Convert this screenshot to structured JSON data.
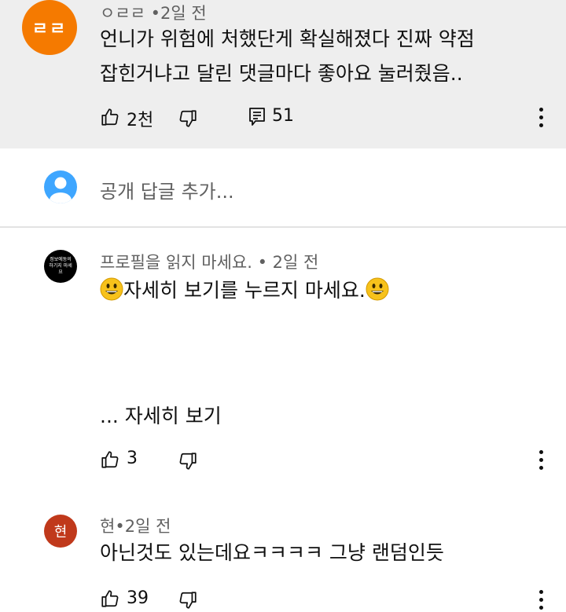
{
  "top_comment": {
    "avatar_text": "ㄹㄹ",
    "author": "ㅇㄹㄹ",
    "separator": "•",
    "time": "2일 전",
    "text_line1": "언니가 위험에 처했단게 확실해졌다 진짜 약점",
    "text_line2": "잡힌거냐고 달린 댓글마다 좋아요 눌러줬음..",
    "likes": "2천",
    "replies": "51"
  },
  "reply_box": {
    "placeholder": "공개 답글 추가..."
  },
  "comment2": {
    "avatar_text": "정보에동의하기지 마세요",
    "author": "프로필을 읽지 마세요.",
    "separator": "•",
    "time": "2일 전",
    "text": "자세히 보기를 누르지 마세요.",
    "more_label": "... 자세히 보기",
    "likes": "3"
  },
  "comment3": {
    "avatar_text": "현",
    "author": "현",
    "separator": "•",
    "time": "2일 전",
    "text": "아닌것도 있는데요ㅋㅋㅋㅋ 그냥 랜덤인듯",
    "likes": "39"
  },
  "colors": {
    "highlight_bg": "#eeeeee",
    "avatar_orange": "#f57a00",
    "avatar_red": "#c0391b",
    "user_avatar_blue": "#3ea6ff"
  }
}
